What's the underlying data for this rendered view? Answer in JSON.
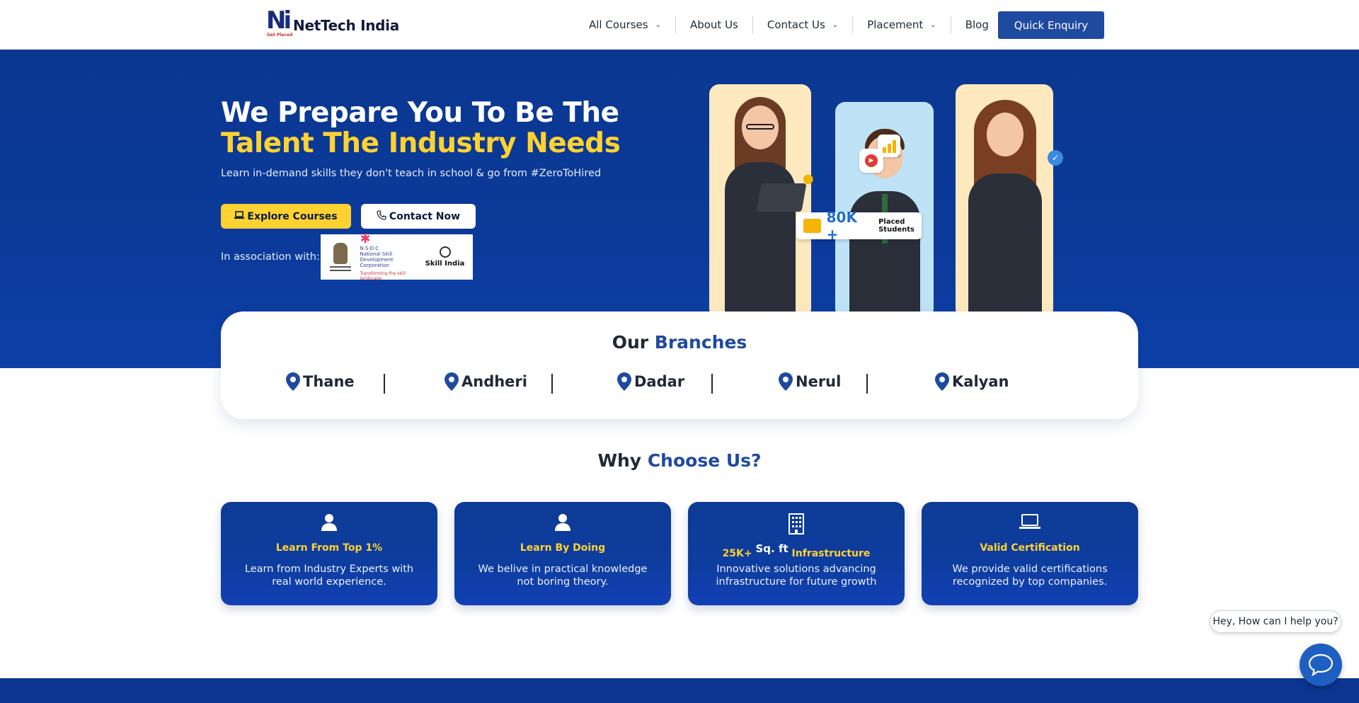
{
  "header": {
    "logo_mark": "Ni",
    "logo_tagline": "Get Placed",
    "logo_text": "NetTech India",
    "nav": [
      {
        "label": "All Courses",
        "has_dropdown": true
      },
      {
        "label": "About Us",
        "has_dropdown": false
      },
      {
        "label": "Contact Us",
        "has_dropdown": true
      },
      {
        "label": "Placement",
        "has_dropdown": true
      },
      {
        "label": "Blog",
        "has_dropdown": false
      }
    ],
    "cta_label": "Quick Enquiry"
  },
  "hero": {
    "title_line1": "We Prepare You To Be The",
    "title_line2": "Talent The Industry Needs",
    "subtitle": "Learn in-demand skills they don't teach in school & go from #ZeroToHired",
    "explore_label": "Explore Courses",
    "contact_label": "Contact Now",
    "association_label": "In association with:",
    "association_logos": {
      "nsdc_top": "N·S·D·C",
      "nsdc_name": "National Skill Development Corporation",
      "nsdc_tagline": "Transforming the skill landscape",
      "skill_india": "Skill India"
    },
    "stat_value": "80K +",
    "stat_label_line1": "Placed",
    "stat_label_line2": "Students"
  },
  "branches": {
    "title_prefix": "Our",
    "title_highlight": "Branches",
    "items": [
      "Thane",
      "Andheri",
      "Dadar",
      "Nerul",
      "Kalyan"
    ]
  },
  "why": {
    "title_prefix": "Why",
    "title_highlight": "Choose Us?",
    "features": [
      {
        "icon": "user-icon",
        "title": "Learn From Top 1%",
        "desc": "Learn from Industry Experts with real world experience."
      },
      {
        "icon": "user-icon",
        "title": "Learn By Doing",
        "desc": "We belive in practical knowledge not boring theory."
      },
      {
        "icon": "building-icon",
        "title_prefix": "25K+",
        "title_sup": "Sq. ft",
        "title_suffix": "Infrastructure",
        "desc": "Innovative solutions advancing infrastructure for future growth"
      },
      {
        "icon": "laptop-icon",
        "title": "Valid Certification",
        "desc": "We provide valid certifications recognized by top companies."
      }
    ]
  },
  "chat": {
    "prompt": "Hey, How can I help you?"
  },
  "colors": {
    "primary_blue": "#0a3790",
    "accent_yellow": "#ffd231",
    "button_blue": "#1e4aa0"
  }
}
